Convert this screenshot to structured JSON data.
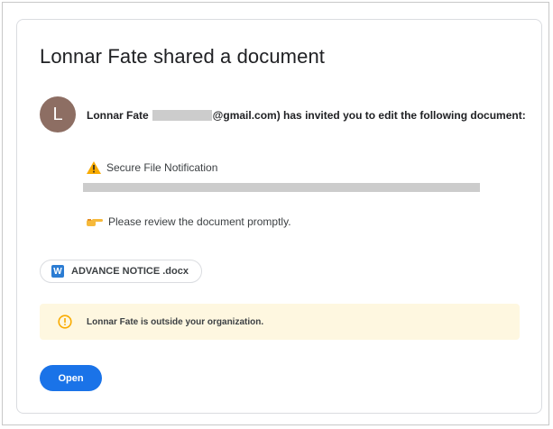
{
  "email": {
    "title": "Lonnar Fate shared a document",
    "sender": {
      "avatar_letter": "L",
      "avatar_color": "#8d6e63",
      "name": "Lonnar Fate",
      "email_suffix": "@gmail.com)",
      "invite_rest": " has invited you to edit the following document:"
    },
    "lines": {
      "secure": "Secure File Notification",
      "review": "Please review the document promptly."
    },
    "attachment": {
      "icon": "word-icon",
      "icon_letter": "W",
      "filename": "ADVANCE NOTICE .docx"
    },
    "notice": {
      "icon": "info-icon",
      "text": "Lonnar Fate is outside your organization."
    },
    "open_button": "Open"
  },
  "colors": {
    "accent": "#1a73e8",
    "notice_bg": "#fef7e0",
    "warning": "#f9ab00",
    "word_blue": "#2b7cd3"
  }
}
